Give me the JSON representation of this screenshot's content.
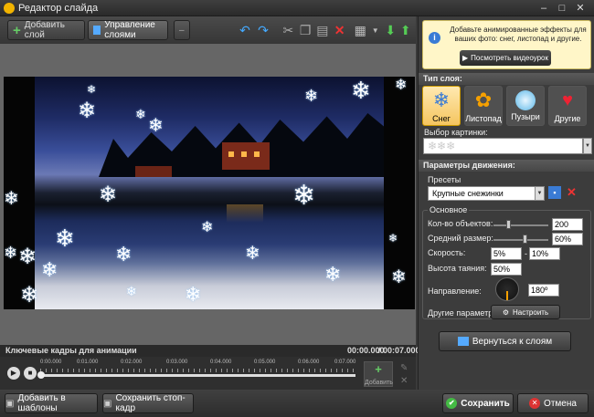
{
  "window": {
    "title": "Редактор слайда",
    "min": "–",
    "max": "□",
    "close": "✕"
  },
  "toolbar": {
    "add_layer": "Добавить слой",
    "manage_layers": "Управление слоями"
  },
  "timeline": {
    "header": "Ключевые кадры для анимации",
    "time_current": "00:00.000",
    "time_total": "00:07.000",
    "ticks": [
      "0:00.000",
      "0:01.000",
      "0:02.000",
      "0:03.000",
      "0:04.000",
      "0:05.000",
      "0:06.000",
      "0:07.000"
    ],
    "add_label": "Добавить"
  },
  "bottom": {
    "add_templates": "Добавить в шаблоны",
    "save_frame": "Сохранить стоп-кадр",
    "save": "Сохранить",
    "cancel": "Отмена"
  },
  "panel": {
    "info_text": "Добавьте анимированные эффекты для ваших фото: снег, листопад и другие.",
    "video_button": "Посмотреть видеоурок",
    "layer_type_header": "Тип слоя:",
    "types": [
      {
        "label": "Снег",
        "icon": "snowflake-icon"
      },
      {
        "label": "Листопад",
        "icon": "leaf-icon"
      },
      {
        "label": "Пузыри",
        "icon": "bubble-icon"
      },
      {
        "label": "Другие",
        "icon": "hearts-icon"
      }
    ],
    "image_choice": "Выбор картинки:",
    "motion_header": "Параметры движения:",
    "presets_label": "Пресеты",
    "preset_value": "Крупные снежинки",
    "basic_label": "Основное",
    "count_label": "Кол-во объектов:",
    "count_value": "200",
    "size_label": "Средний размер:",
    "size_value": "60%",
    "speed_label": "Скорость:",
    "speed_min": "5%",
    "speed_max": "10%",
    "melt_label": "Высота таяния:",
    "melt_value": "50%",
    "direction_label": "Направление:",
    "direction_value": "180º",
    "other_label": "Другие параметры:",
    "configure": "Настроить",
    "back_button": "Вернуться к слоям"
  }
}
